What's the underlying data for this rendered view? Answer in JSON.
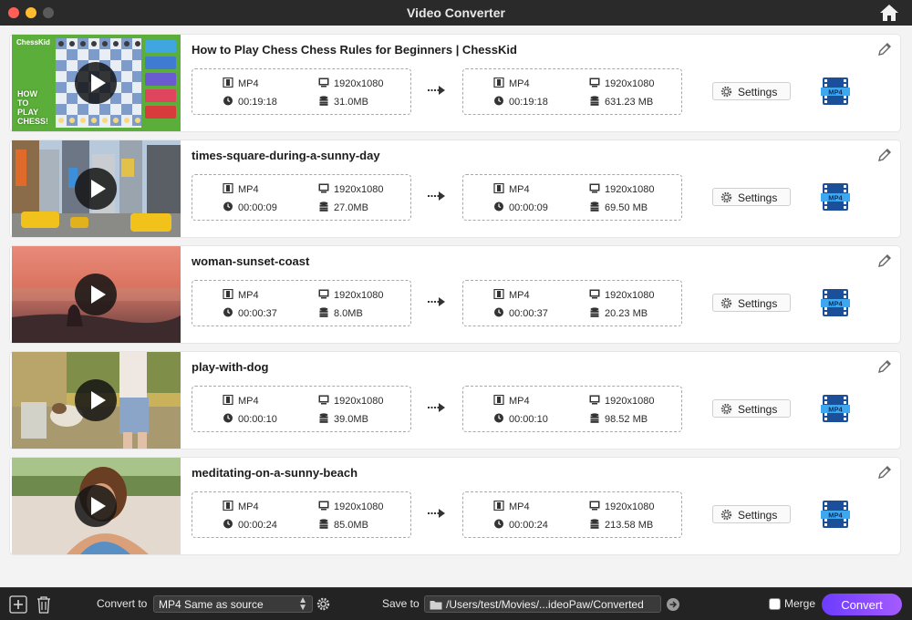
{
  "window": {
    "title": "Video Converter"
  },
  "icons": {
    "home": "home-icon",
    "edit": "pencil-icon",
    "format": "film-icon",
    "resolution": "monitor-icon",
    "duration": "clock-icon",
    "size": "database-icon",
    "arrow": "arrow-right-icon",
    "settings": "gear-icon",
    "output": "mp4-film-icon"
  },
  "colors": {
    "accent": "#7b46ff",
    "close": "#ff5f57",
    "minimize": "#febc2e"
  },
  "videos": [
    {
      "title": "How to Play Chess  Chess Rules for Beginners | ChessKid",
      "source": {
        "format": "MP4",
        "resolution": "1920x1080",
        "duration": "00:19:18",
        "size": "31.0MB"
      },
      "output": {
        "format": "MP4",
        "resolution": "1920x1080",
        "duration": "00:19:18",
        "size": "631.23 MB"
      },
      "settings_label": "Settings",
      "thumb_text": {
        "brand": "ChessKid",
        "line1": "HOW",
        "line2": "TO",
        "line3": "PLAY",
        "line4": "CHESS!"
      }
    },
    {
      "title": "times-square-during-a-sunny-day",
      "source": {
        "format": "MP4",
        "resolution": "1920x1080",
        "duration": "00:00:09",
        "size": "27.0MB"
      },
      "output": {
        "format": "MP4",
        "resolution": "1920x1080",
        "duration": "00:00:09",
        "size": "69.50 MB"
      },
      "settings_label": "Settings"
    },
    {
      "title": "woman-sunset-coast",
      "source": {
        "format": "MP4",
        "resolution": "1920x1080",
        "duration": "00:00:37",
        "size": "8.0MB"
      },
      "output": {
        "format": "MP4",
        "resolution": "1920x1080",
        "duration": "00:00:37",
        "size": "20.23 MB"
      },
      "settings_label": "Settings"
    },
    {
      "title": "play-with-dog",
      "source": {
        "format": "MP4",
        "resolution": "1920x1080",
        "duration": "00:00:10",
        "size": "39.0MB"
      },
      "output": {
        "format": "MP4",
        "resolution": "1920x1080",
        "duration": "00:00:10",
        "size": "98.52 MB"
      },
      "settings_label": "Settings"
    },
    {
      "title": "meditating-on-a-sunny-beach",
      "source": {
        "format": "MP4",
        "resolution": "1920x1080",
        "duration": "00:00:24",
        "size": "85.0MB"
      },
      "output": {
        "format": "MP4",
        "resolution": "1920x1080",
        "duration": "00:00:24",
        "size": "213.58 MB"
      },
      "settings_label": "Settings"
    }
  ],
  "bottom_bar": {
    "convert_to_label": "Convert to",
    "convert_to_value": "MP4 Same as source",
    "save_to_label": "Save to",
    "save_to_path": "/Users/test/Movies/...ideoPaw/Converted",
    "merge_label": "Merge",
    "merge_checked": false,
    "convert_button": "Convert"
  }
}
